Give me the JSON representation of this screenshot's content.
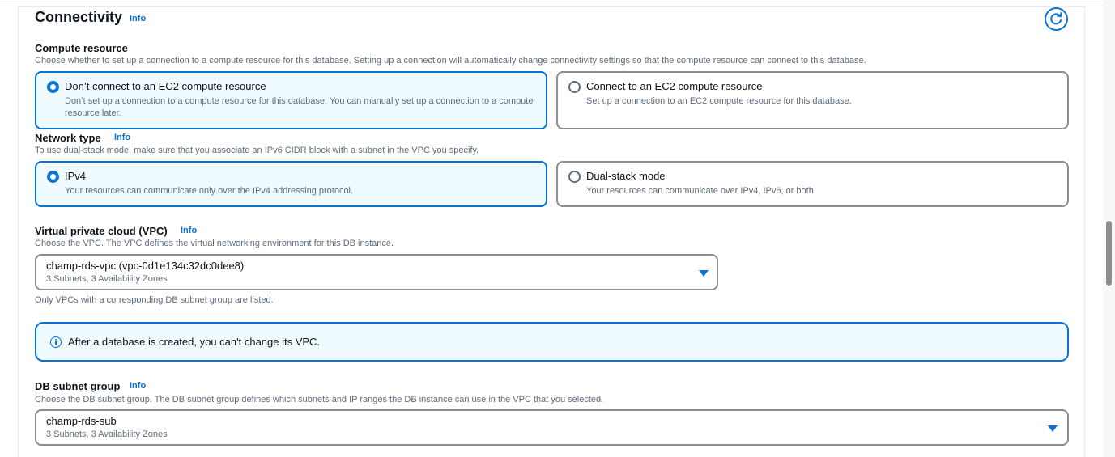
{
  "section": {
    "title": "Connectivity",
    "info": "Info"
  },
  "compute": {
    "label": "Compute resource",
    "description": "Choose whether to set up a connection to a compute resource for this database. Setting up a connection will automatically change connectivity settings so that the compute resource can connect to this database.",
    "options": [
      {
        "title": "Don’t connect to an EC2 compute resource",
        "description": "Don’t set up a connection to a compute resource for this database. You can manually set up a connection to a compute resource later.",
        "selected": true
      },
      {
        "title": "Connect to an EC2 compute resource",
        "description": "Set up a connection to an EC2 compute resource for this database.",
        "selected": false
      }
    ]
  },
  "network": {
    "label": "Network type",
    "info": "Info",
    "description": "To use dual-stack mode, make sure that you associate an IPv6 CIDR block with a subnet in the VPC you specify.",
    "options": [
      {
        "title": "IPv4",
        "description": "Your resources can communicate only over the IPv4 addressing protocol.",
        "selected": true
      },
      {
        "title": "Dual-stack mode",
        "description": "Your resources can communicate over IPv4, IPv6, or both.",
        "selected": false
      }
    ]
  },
  "vpc": {
    "label": "Virtual private cloud (VPC)",
    "info": "Info",
    "description": "Choose the VPC. The VPC defines the virtual networking environment for this DB instance.",
    "value": "champ-rds-vpc (vpc-0d1e134c32dc0dee8)",
    "sub": "3 Subnets, 3 Availability Zones",
    "constraint": "Only VPCs with a corresponding DB subnet group are listed."
  },
  "alert": {
    "text": "After a database is created, you can't change its VPC."
  },
  "subnet": {
    "label": "DB subnet group",
    "info": "Info",
    "description": "Choose the DB subnet group. The DB subnet group defines which subnets and IP ranges the DB instance can use in the VPC that you selected.",
    "value": "champ-rds-sub",
    "sub": "3 Subnets, 3 Availability Zones"
  },
  "icons": {
    "refresh": "refresh-icon",
    "info": "info-circle-icon",
    "caret": "caret-down-icon"
  },
  "colors": {
    "accent": "#0972d3",
    "selected_bg": "#f0fbff",
    "border": "#8c8c94"
  }
}
